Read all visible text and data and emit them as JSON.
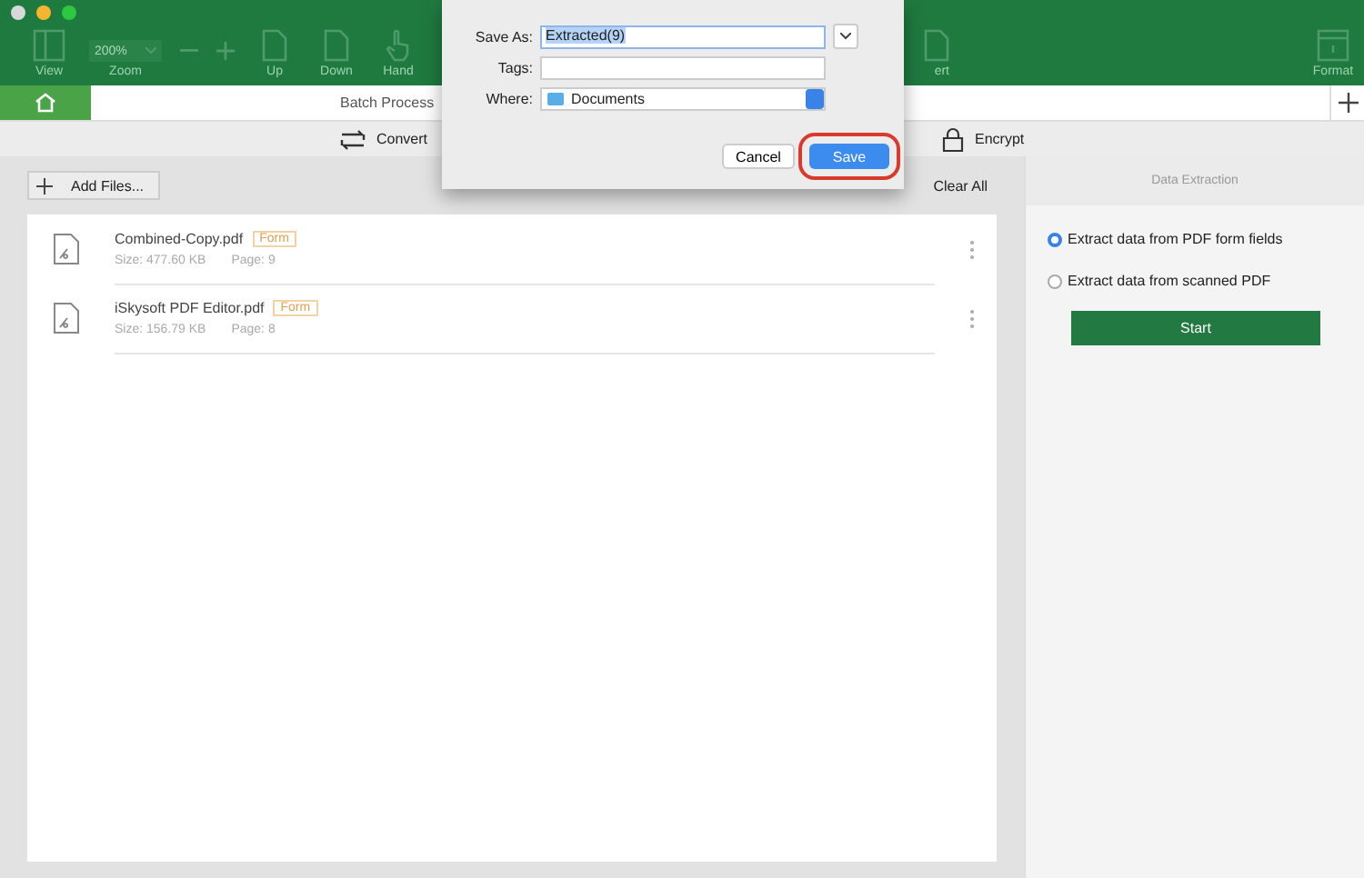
{
  "toolbar": {
    "left": [
      {
        "kind": "view",
        "label": "View"
      },
      {
        "kind": "zoom",
        "label": "Zoom",
        "value": "200%"
      },
      {
        "kind": "minus"
      },
      {
        "kind": "plus"
      },
      {
        "kind": "up",
        "label": "Up"
      },
      {
        "kind": "down",
        "label": "Down"
      },
      {
        "kind": "hand",
        "label": "Hand"
      }
    ],
    "partial": {
      "kind": "page",
      "label": "ert"
    },
    "right": {
      "kind": "format",
      "label": "Format"
    }
  },
  "tabbar": {
    "title": "Batch Process"
  },
  "operations": [
    {
      "kind": "convert",
      "label": "Convert"
    },
    {
      "kind": "encrypt",
      "label": "Encrypt"
    }
  ],
  "add_files": "Add Files...",
  "clear_all": "Clear All",
  "files": [
    {
      "name": "Combined-Copy.pdf",
      "tag": "Form",
      "size": "Size: 477.60 KB",
      "pages": "Page: 9"
    },
    {
      "name": "iSkysoft PDF Editor.pdf",
      "tag": "Form",
      "size": "Size: 156.79 KB",
      "pages": "Page: 8"
    }
  ],
  "panel": {
    "title": "Data Extraction",
    "options": [
      {
        "label": "Extract data from PDF form fields",
        "selected": true
      },
      {
        "label": "Extract data from scanned PDF",
        "selected": false
      }
    ],
    "button": "Start"
  },
  "dialog": {
    "save_as_label": "Save As:",
    "save_as": "Extracted(9)",
    "tags_label": "Tags:",
    "where_label": "Where:",
    "where": "Documents",
    "cancel": "Cancel",
    "save": "Save"
  }
}
